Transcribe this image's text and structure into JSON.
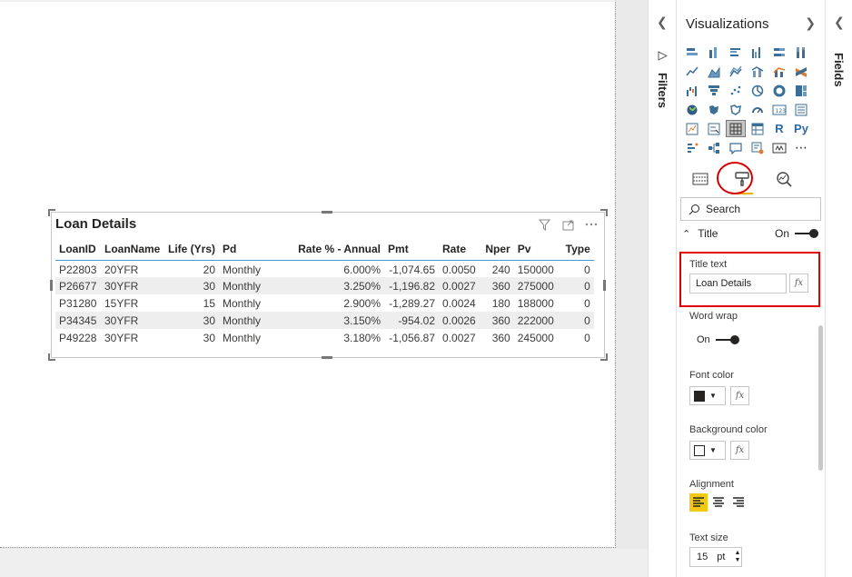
{
  "visual": {
    "title": "Loan Details",
    "columns": [
      "LoanID",
      "LoanName",
      "Life (Yrs)",
      "Pd",
      "Rate % - Annual",
      "Pmt",
      "Rate",
      "Nper",
      "Pv",
      "Type"
    ],
    "rows": [
      [
        "P22803",
        "20YFR",
        "20",
        "Monthly",
        "6.000%",
        "-1,074.65",
        "0.0050",
        "240",
        "150000",
        "0"
      ],
      [
        "P26677",
        "30YFR",
        "30",
        "Monthly",
        "3.250%",
        "-1,196.82",
        "0.0027",
        "360",
        "275000",
        "0"
      ],
      [
        "P31280",
        "15YFR",
        "15",
        "Monthly",
        "2.900%",
        "-1,289.27",
        "0.0024",
        "180",
        "188000",
        "0"
      ],
      [
        "P34345",
        "30YFR",
        "30",
        "Monthly",
        "3.150%",
        "-954.02",
        "0.0026",
        "360",
        "222000",
        "0"
      ],
      [
        "P49228",
        "30YFR",
        "30",
        "Monthly",
        "3.180%",
        "-1,056.87",
        "0.0027",
        "360",
        "245000",
        "0"
      ]
    ],
    "icons": [
      "filter-icon",
      "focus-mode-icon",
      "more-options-icon"
    ]
  },
  "filters": {
    "label": "Filters"
  },
  "fields": {
    "label": "Fields"
  },
  "viz_pane": {
    "title": "Visualizations",
    "r_label": "R",
    "py_label": "Py",
    "more_label": "⋯",
    "search_placeholder": "Search",
    "section_title": "Title",
    "section_toggle": "On",
    "title_text_label": "Title text",
    "title_text_value": "Loan Details",
    "fx_label": "fx",
    "word_wrap_label": "Word wrap",
    "word_wrap_value": "On",
    "font_color_label": "Font color",
    "font_color": "#252423",
    "background_color_label": "Background color",
    "background_color": "#ffffff",
    "alignment_label": "Alignment",
    "text_size_label": "Text size",
    "text_size_value": "15",
    "text_size_unit": "pt"
  },
  "colors": {
    "accent": "#f2c811",
    "highlight_red": "#e00000",
    "table_rule": "#3f9ad6"
  }
}
